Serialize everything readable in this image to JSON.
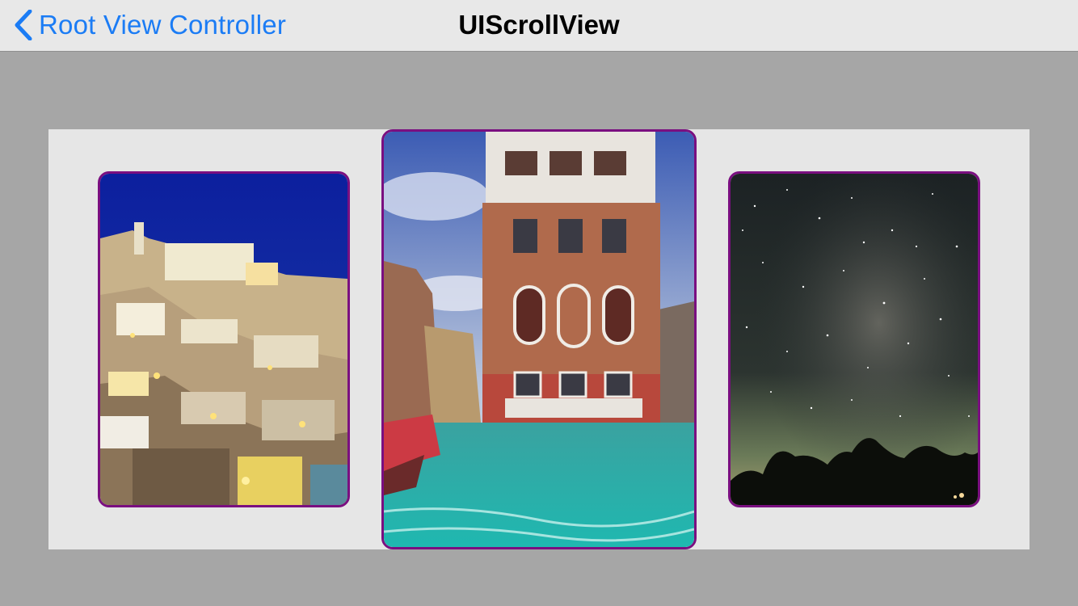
{
  "navbar": {
    "back_label": "Root View Controller",
    "title": "UIScrollView",
    "back_icon": "chevron-left-icon",
    "tint_color": "#1b7cf5"
  },
  "scroll_view": {
    "background_color": "#e6e6e6",
    "card_border_color": "#7a0f80",
    "cards": [
      {
        "name": "santorini-night-photo"
      },
      {
        "name": "venice-canal-building-photo"
      },
      {
        "name": "milky-way-night-sky-photo"
      }
    ]
  }
}
